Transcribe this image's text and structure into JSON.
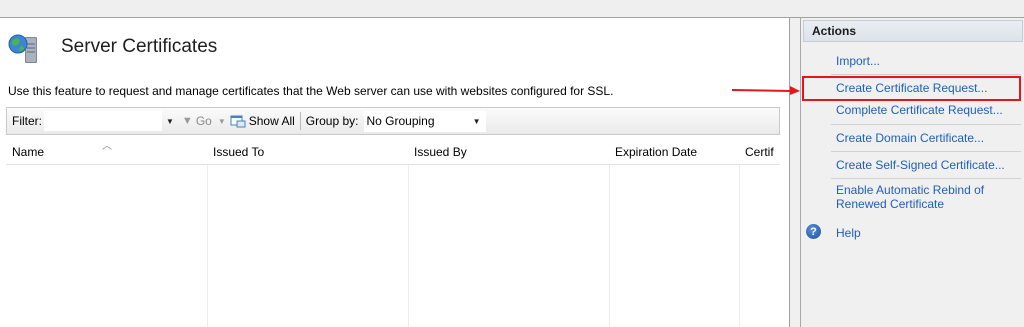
{
  "page": {
    "title": "Server Certificates",
    "description": "Use this feature to request and manage certificates that the Web server can use with websites configured for SSL."
  },
  "filterbar": {
    "filter_label": "Filter:",
    "filter_value": "",
    "go_label": "Go",
    "show_all_label": "Show All",
    "group_by_label": "Group by:",
    "group_by_value": "No Grouping"
  },
  "table": {
    "columns": [
      "Name",
      "Issued To",
      "Issued By",
      "Expiration Date",
      "Certif"
    ],
    "rows": []
  },
  "actions": {
    "header": "Actions",
    "import": "Import...",
    "create_request": "Create Certificate Request...",
    "complete_request": "Complete Certificate Request...",
    "create_domain": "Create Domain Certificate...",
    "create_self_signed": "Create Self-Signed Certificate...",
    "rebind_line1": "Enable Automatic Rebind of",
    "rebind_line2": "Renewed Certificate",
    "help": "Help"
  },
  "colors": {
    "link": "#1f5fb8",
    "highlight": "#e3171b"
  },
  "icons": {
    "feature": "server-certificates-icon",
    "filter": "funnel-icon",
    "show_all": "show-all-icon",
    "help": "help-icon",
    "sort": "sort-caret-icon"
  }
}
